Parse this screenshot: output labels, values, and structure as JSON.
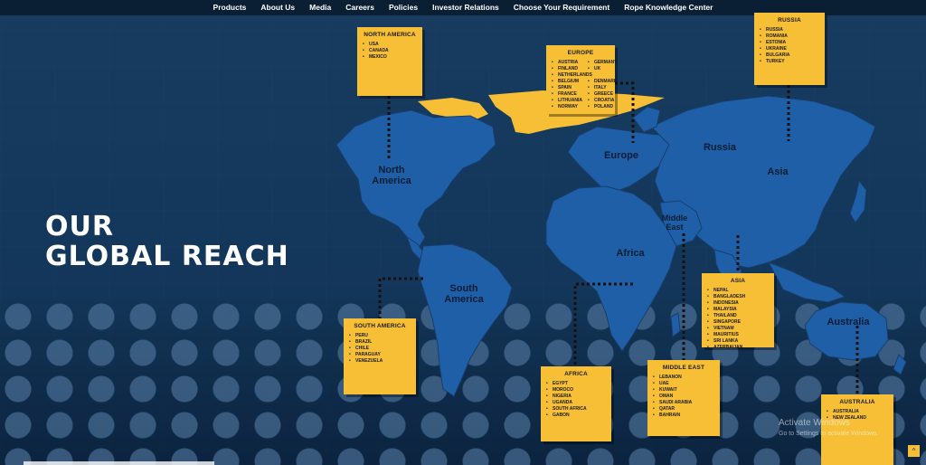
{
  "nav": {
    "items": [
      "Products",
      "About Us",
      "Media",
      "Careers",
      "Policies",
      "Investor Relations",
      "Choose Your Requirement",
      "Rope Knowledge Center"
    ]
  },
  "headline": {
    "line1": "OUR",
    "line2": "GLOBAL REACH"
  },
  "map_labels": {
    "north_america": "North America",
    "south_america": "South America",
    "europe": "Europe",
    "russia": "Russia",
    "asia": "Asia",
    "africa": "Africa",
    "middle_east": "Middle East",
    "australia": "Australia"
  },
  "cards": {
    "north_america": {
      "title": "NORTH AMERICA",
      "items": [
        "USA",
        "CANADA",
        "MEXICO"
      ]
    },
    "europe": {
      "title": "EUROPE",
      "items": [
        "AUSTRIA",
        "GERMANY",
        "FINLAND",
        "UK",
        "NETHERLANDS",
        "",
        "BELGIUM",
        "DENMARK",
        "SPAIN",
        "ITALY",
        "FRANCE",
        "GREECE",
        "LITHUANIA",
        "CROATIA",
        "NORWAY",
        "POLAND"
      ]
    },
    "russia": {
      "title": "RUSSIA",
      "items": [
        "RUSSIA",
        "ROMANIA",
        "ESTONIA",
        "UKRAINE",
        "BULGARIA",
        "TURKEY"
      ]
    },
    "asia": {
      "title": "ASIA",
      "items": [
        "NEPAL",
        "BANGLADESH",
        "INDONESIA",
        "MALAYSIA",
        "THAILAND",
        "SINGAPORE",
        "VIETNAM",
        "MAURITIUS",
        "SRI LANKA",
        "AZERBAIJAN"
      ]
    },
    "south_america": {
      "title": "SOUTH AMERICA",
      "items": [
        "PERU",
        "BRAZIL",
        "CHILE",
        "PARAGUAY",
        "VENEZUELA"
      ]
    },
    "africa": {
      "title": "AFRICA",
      "items": [
        "EGYPT",
        "MOROCO",
        "NIGERIA",
        "UGANDA",
        "SOUTH AFRICA",
        "GABON"
      ]
    },
    "middle_east": {
      "title": "MIDDLE EAST",
      "items": [
        "LEBANON",
        "UAE",
        "KUWAIT",
        "OMAN",
        "SAUDI ARABIA",
        "QATAR",
        "BAHRAIN"
      ]
    },
    "australia": {
      "title": "AUSTRALIA",
      "items": [
        "AUSTRALIA",
        "NEW ZEALAND"
      ]
    }
  },
  "watermark": {
    "title": "Activate Windows",
    "subtitle": "Go to Settings to activate Windows."
  },
  "scroll_top": {
    "icon": "chevron-up-icon",
    "glyph": "^"
  },
  "colors": {
    "map_blue": "#1f5fa8",
    "highlight_yellow": "#f6bf36",
    "nav_bg": "#0a1f33"
  }
}
